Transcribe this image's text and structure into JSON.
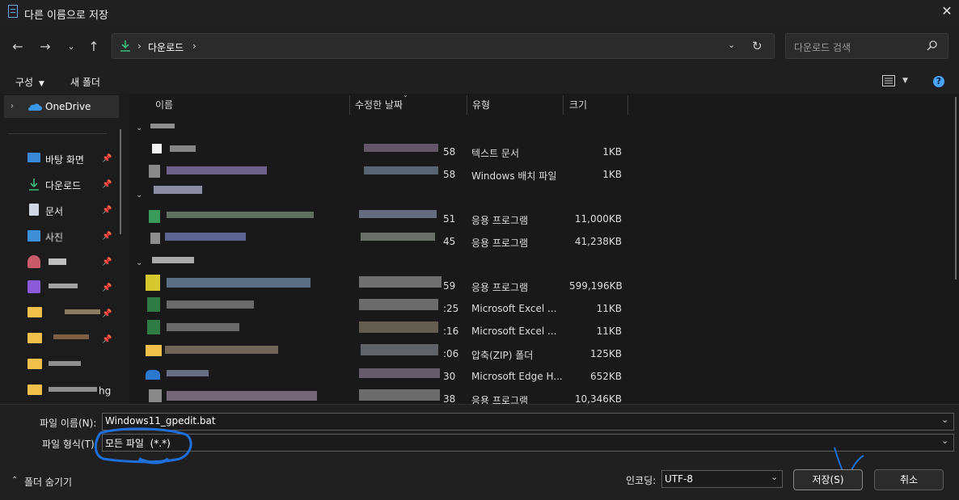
{
  "window": {
    "title": "다른 이름으로 저장"
  },
  "address": {
    "crumb": "다운로드",
    "separator": "›",
    "search_placeholder": "다운로드 검색"
  },
  "toolbar": {
    "organize": "구성",
    "new_folder": "새 폴더"
  },
  "sidebar": {
    "onedrive": "OneDrive",
    "items": [
      {
        "label": "바탕 화면",
        "icon": "desktop-icon"
      },
      {
        "label": "다운로드",
        "icon": "download-icon"
      },
      {
        "label": "문서",
        "icon": "document-icon"
      },
      {
        "label": "사진",
        "icon": "pictures-icon"
      }
    ],
    "partial_label": "hg"
  },
  "columns": [
    "이름",
    "수정한 날짜",
    "유형",
    "크기"
  ],
  "rows": [
    {
      "date_tail": "58",
      "type": "텍스트 문서",
      "size": "1KB"
    },
    {
      "date_tail": "58",
      "type": "Windows 배치 파일",
      "size": "1KB"
    },
    {
      "date_tail": "51",
      "type": "응용 프로그램",
      "size": "11,000KB"
    },
    {
      "date_tail": "45",
      "type": "응용 프로그램",
      "size": "41,238KB"
    },
    {
      "date_tail": "59",
      "type": "응용 프로그램",
      "size": "599,196KB"
    },
    {
      "date_tail": ":25",
      "type": "Microsoft Excel ...",
      "size": "11KB"
    },
    {
      "date_tail": ":16",
      "type": "Microsoft Excel ...",
      "size": "11KB"
    },
    {
      "date_tail": ":06",
      "type": "압축(ZIP) 폴더",
      "size": "125KB"
    },
    {
      "date_tail": "30",
      "type": "Microsoft Edge H...",
      "size": "652KB"
    },
    {
      "date_tail": "38",
      "type": "응용 프로그램",
      "size": "10,346KB"
    }
  ],
  "form": {
    "filename_label": "파일 이름(N):",
    "filename_value": "Windows11_gpedit.bat",
    "filetype_label": "파일 형식(T):",
    "filetype_value": "모든 파일  (*.*)",
    "hide_folders": "폴더 숨기기",
    "encoding_label": "인코딩:",
    "encoding_value": "UTF-8",
    "save": "저장(S)",
    "cancel": "취소"
  },
  "colors": {
    "accent": "#4aa3ff",
    "annotation": "#1e6fd9"
  }
}
